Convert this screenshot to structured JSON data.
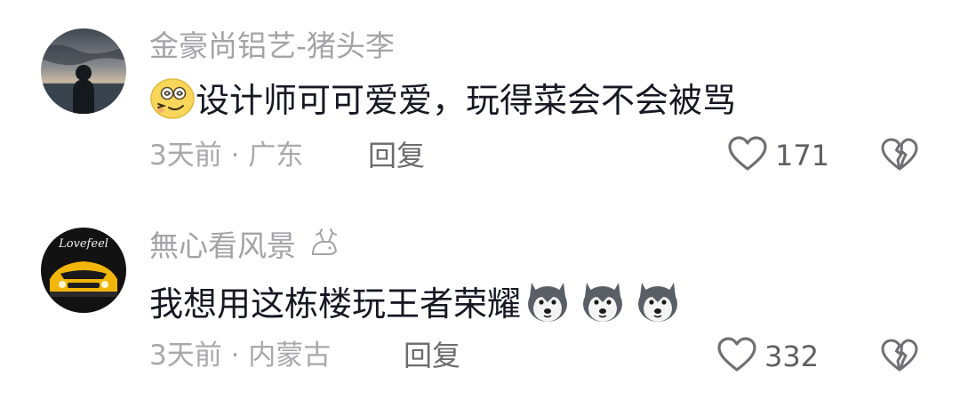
{
  "comments": [
    {
      "username": "金豪尚铝艺-猪头李",
      "text": "设计师可可爱爱，玩得菜会不会被骂",
      "time_location": "3天前 · 广东",
      "reply_label": "回复",
      "likes": "171"
    },
    {
      "username": "無心看风景",
      "text": "我想用这栋楼玩王者荣耀",
      "time_location": "3天前 · 内蒙古",
      "reply_label": "回复",
      "likes": "332",
      "avatar_text": "Lovefeel"
    }
  ],
  "colors": {
    "username": "#a3a3a8",
    "body": "#161823",
    "meta": "#a8a8ad",
    "reply": "#6b6b70",
    "like_icon": "#6f6f74"
  },
  "icons": [
    "heart-outline-icon",
    "broken-heart-icon",
    "giggle-emoji-icon",
    "husky-dog-emoji-icon"
  ]
}
